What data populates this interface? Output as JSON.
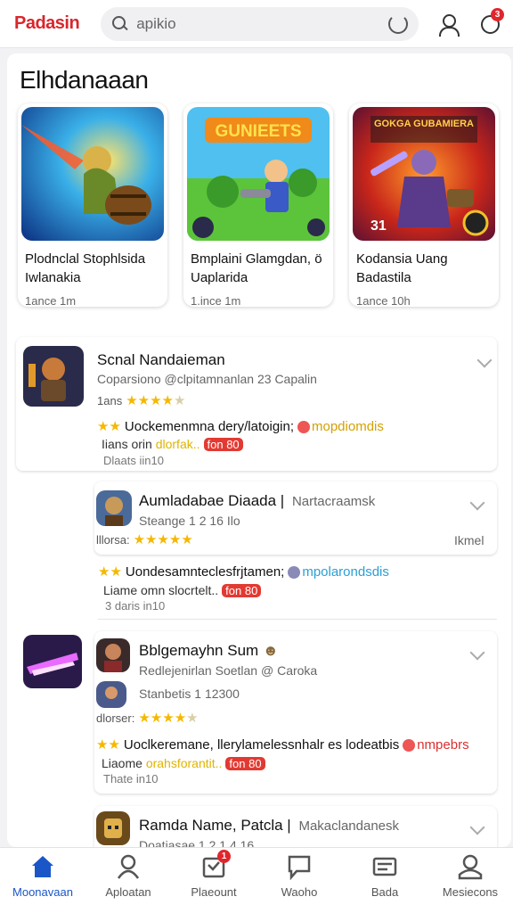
{
  "header": {
    "brand": "Padasin",
    "search_value": "apikio",
    "notification_count": "3"
  },
  "featured": {
    "title": "Elhdanaaan",
    "cards": [
      {
        "title": "Plodnclal Stophlsida Iwlanakia",
        "meta": "1ance 1m"
      },
      {
        "title": "Bmplaini Glamgdan, ö Uaplarida",
        "meta": "1.ince 1m"
      },
      {
        "title": "Kodansia Uang Badastila",
        "meta": "1ance 10h"
      }
    ],
    "card_art_text": [
      "GUNIEETS",
      "GOKGA GUBAMIERA",
      "31"
    ]
  },
  "list": {
    "item1": {
      "name": "Scnal Nandaieman",
      "sub": "Coparsiono @clpitamnanlan 23 Capalin",
      "rating_label": "1ans",
      "promo": "Uockemenmna dery/latoigin;",
      "promo_tag": "mopdiomdis",
      "price_label": "Iians orin",
      "price_yellow": "dlorfak..",
      "price_pill": "fon 80",
      "date": "Dlaats iin10"
    },
    "item2": {
      "name": "Aumladabae Diaada",
      "side": "Nartacraamsk",
      "sub": "Steange 1 2 16 Ilo",
      "rating_label": "lllorsa:",
      "right": "Ikmel",
      "promo": "Uondesamnteclesfrjtamen;",
      "promo_tag": "mpolarondsdis",
      "price_label": "Liame omn",
      "price_dark": "slocrtelt..",
      "price_pill": "fon 80",
      "date": "3 daris in10"
    },
    "item3": {
      "name": "Bblgemayhn Sum",
      "sub": "Redlejenirlan Soetlan @ Caroka",
      "sub2": "Stanbetis 1 12300",
      "rating_label": "dlorser:",
      "promo": "Uoclkeremane, llerylamelessnhalr es lodeatbis",
      "promo_tag": "nmpebrs",
      "price_label": "Liaome",
      "price_yellow": "orahsforantit..",
      "price_pill": "fon 80",
      "date": "Thate in10"
    },
    "item4": {
      "name": "Ramda Name, Patcla",
      "side": "Makaclandanesk",
      "sub": "Doatiasae 1 2 1 4 16"
    }
  },
  "bottom_nav": [
    {
      "label": "Moonavaan",
      "icon": "home-icon"
    },
    {
      "label": "Aploatan",
      "icon": "person-icon"
    },
    {
      "label": "Plaeount",
      "icon": "gift-icon",
      "badge": "1"
    },
    {
      "label": "Waoho",
      "icon": "chat-icon"
    },
    {
      "label": "Bada",
      "icon": "card-icon"
    },
    {
      "label": "Mesiecons",
      "icon": "profile-icon"
    }
  ],
  "colors": {
    "brand": "#d9262c",
    "accent": "#1a56c8",
    "star": "#f5b800",
    "pill": "#e23a32"
  }
}
